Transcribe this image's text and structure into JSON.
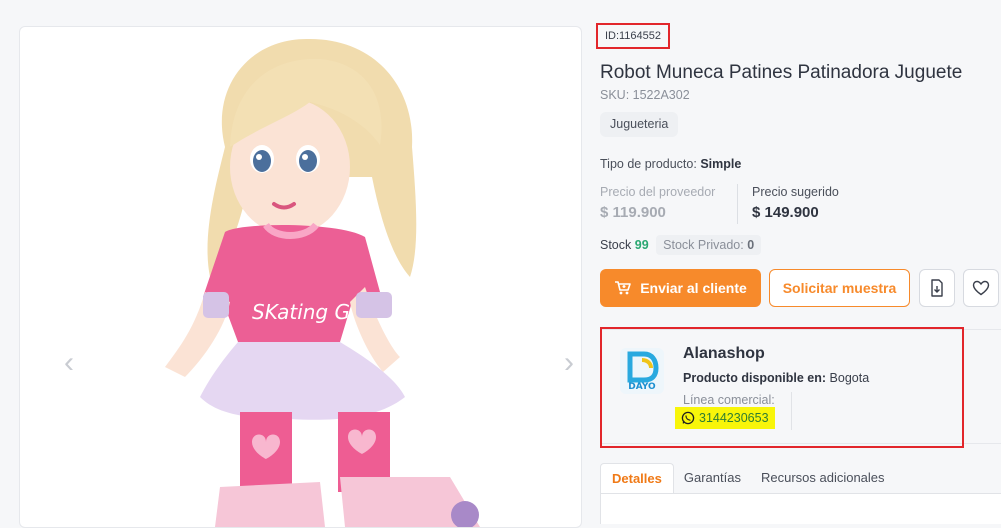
{
  "product": {
    "id": "ID:1164552",
    "title": "Robot Muneca Patines Patinadora Juguete",
    "sku": "SKU: 1522A302",
    "category_tag": "Jugueteria",
    "type_label": "Tipo de producto:",
    "type_value": "Simple",
    "image_text": "SKating Girl"
  },
  "prices": {
    "supplier_label": "Precio del proveedor",
    "supplier_value": "$ 119.900",
    "suggested_label": "Precio sugerido",
    "suggested_value": "$ 149.900"
  },
  "stock": {
    "label": "Stock",
    "value": "99",
    "private_label": "Stock Privado:",
    "private_value": "0"
  },
  "actions": {
    "send_label": "Enviar al cliente",
    "sample_label": "Solicitar muestra",
    "download_icon": "download-icon",
    "favorite_icon": "heart-icon"
  },
  "seller": {
    "name": "Alanashop",
    "logo_text": "DAYO",
    "available_label": "Producto disponible en:",
    "available_value": "Bogota",
    "line_label": "Línea comercial:",
    "phone": "3144230653"
  },
  "tabs": [
    {
      "label": "Detalles"
    },
    {
      "label": "Garantías"
    },
    {
      "label": "Recursos adicionales"
    }
  ],
  "colors": {
    "accent": "#f78a2b",
    "highlight_border": "#e2262b",
    "stock_green": "#2aa872"
  }
}
